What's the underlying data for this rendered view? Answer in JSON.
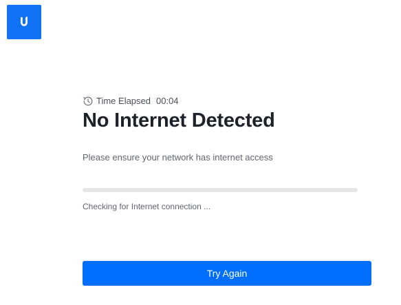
{
  "brand": {
    "logo_icon": "ubiquiti-u-logo-icon",
    "color": "#1272f5"
  },
  "timer": {
    "label": "Time Elapsed",
    "value": "00:04",
    "icon": "clock-icon"
  },
  "main": {
    "title": "No Internet Detected",
    "subtitle": "Please ensure your network has internet access",
    "progress": 0,
    "status": "Checking for Internet connection ..."
  },
  "actions": {
    "try_again_label": "Try Again",
    "button_color": "#006fff"
  }
}
